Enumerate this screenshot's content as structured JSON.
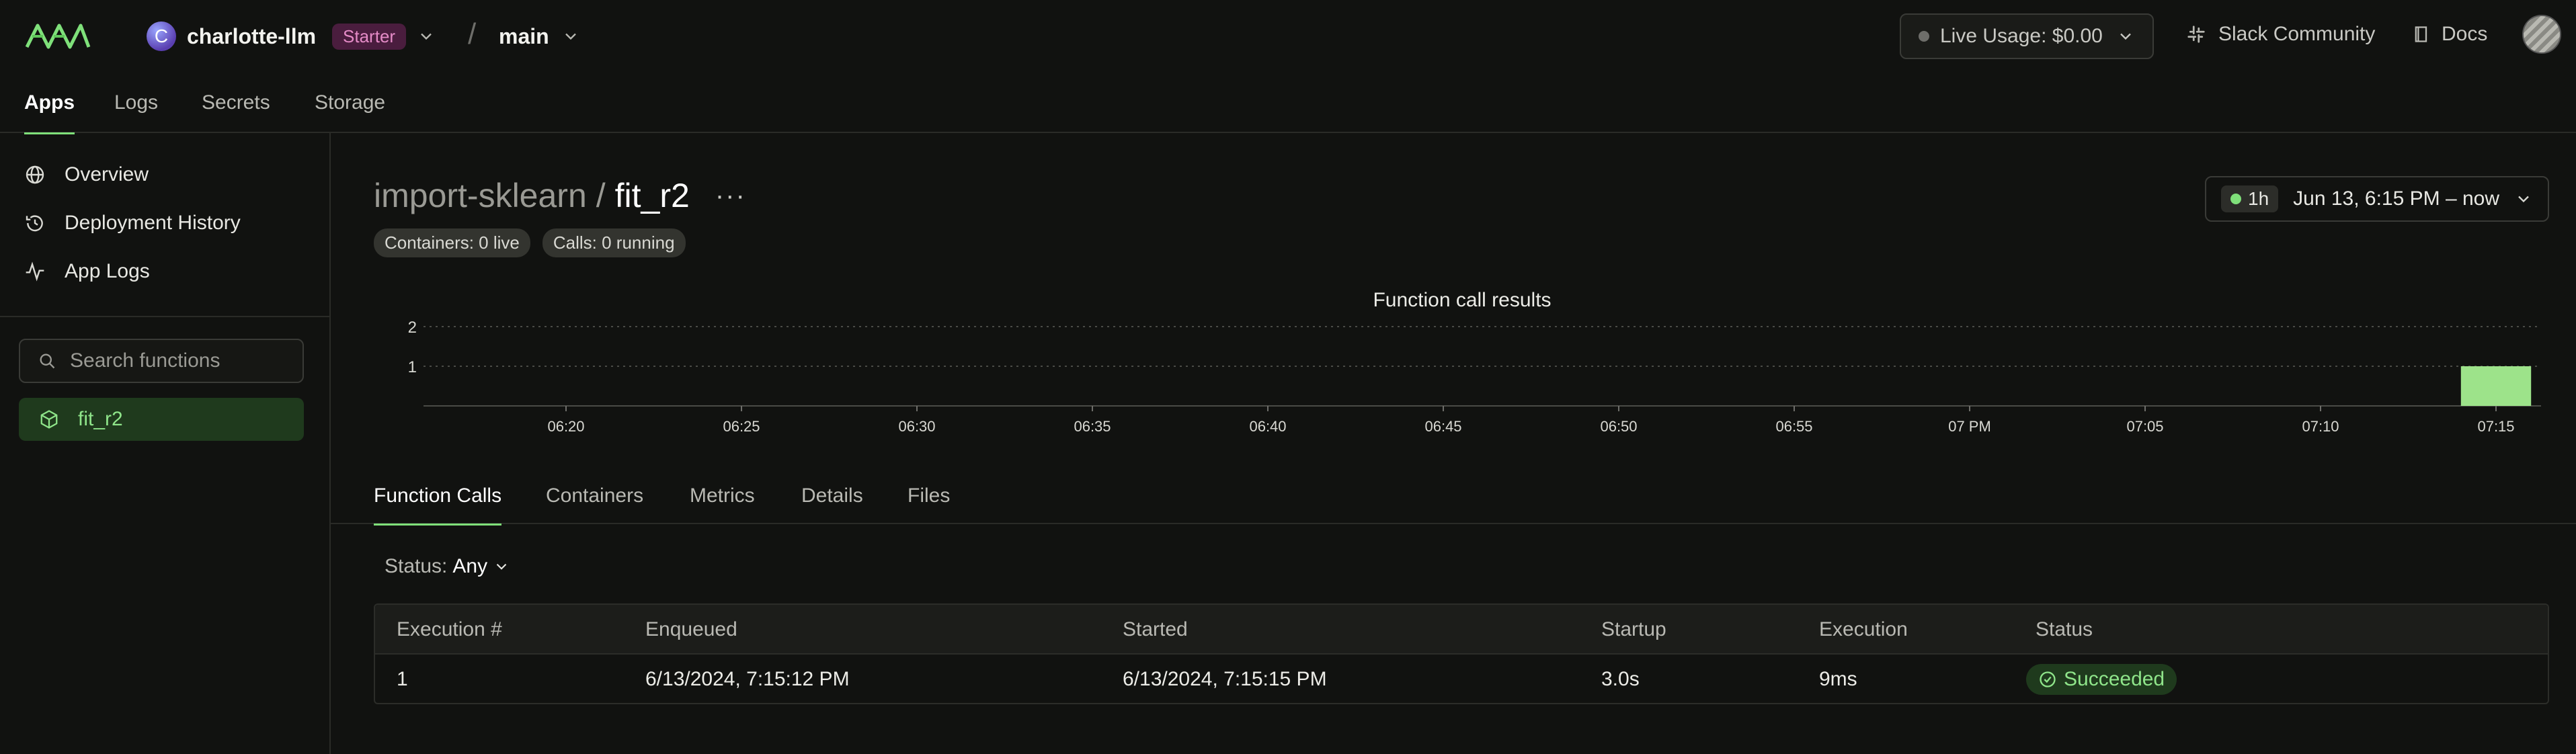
{
  "header": {
    "workspace_initial": "C",
    "workspace_name": "charlotte-llm",
    "plan_badge": "Starter",
    "separator": "/",
    "environment": "main",
    "live_usage": "Live Usage: $0.00",
    "slack_label": "Slack Community",
    "docs_label": "Docs"
  },
  "nav": {
    "tabs": [
      "Apps",
      "Logs",
      "Secrets",
      "Storage"
    ],
    "active": "Apps"
  },
  "sidebar": {
    "items": [
      {
        "label": "Overview",
        "icon": "globe-icon"
      },
      {
        "label": "Deployment History",
        "icon": "history-icon"
      },
      {
        "label": "App Logs",
        "icon": "activity-icon"
      }
    ],
    "search_placeholder": "Search functions",
    "functions": [
      {
        "label": "fit_r2",
        "icon": "cube-icon"
      }
    ]
  },
  "main": {
    "app_name": "import-sklearn",
    "title_separator": "/",
    "function_name": "fit_r2",
    "pills": [
      "Containers: 0 live",
      "Calls: 0 running"
    ],
    "time_range": {
      "badge": "1h",
      "label": "Jun 13, 6:15 PM – now"
    },
    "subtabs": [
      "Function Calls",
      "Containers",
      "Metrics",
      "Details",
      "Files"
    ],
    "active_subtab": "Function Calls",
    "filter": {
      "key": "Status:",
      "value": "Any"
    },
    "table": {
      "columns": [
        "Execution #",
        "Enqueued",
        "Started",
        "Startup",
        "Execution",
        "Status"
      ],
      "rows": [
        {
          "execution": "1",
          "enqueued": "6/13/2024, 7:15:12 PM",
          "started": "6/13/2024, 7:15:15 PM",
          "startup": "3.0s",
          "execution_time": "9ms",
          "status": "Succeeded"
        }
      ]
    }
  },
  "chart_data": {
    "type": "bar",
    "title": "Function call results",
    "xlabel": "",
    "ylabel": "",
    "categories": [
      "06:20",
      "06:25",
      "06:30",
      "06:35",
      "06:40",
      "06:45",
      "06:50",
      "06:55",
      "07 PM",
      "07:05",
      "07:10",
      "07:15"
    ],
    "y_ticks": [
      "1",
      "2"
    ],
    "ylim": [
      0,
      2
    ],
    "bars": [
      {
        "x_start": "07:14",
        "x_end": "07:16",
        "value": 1,
        "color": "#9de38a"
      }
    ],
    "grid": "dotted horizontal",
    "legend": "none"
  },
  "colors": {
    "accent": "#7fe07a",
    "background": "#111210",
    "badge_bg": "#4a1d3e",
    "badge_text": "#e58bc7",
    "success_bg": "#1f3a1d",
    "success_text": "#8fe58a"
  }
}
